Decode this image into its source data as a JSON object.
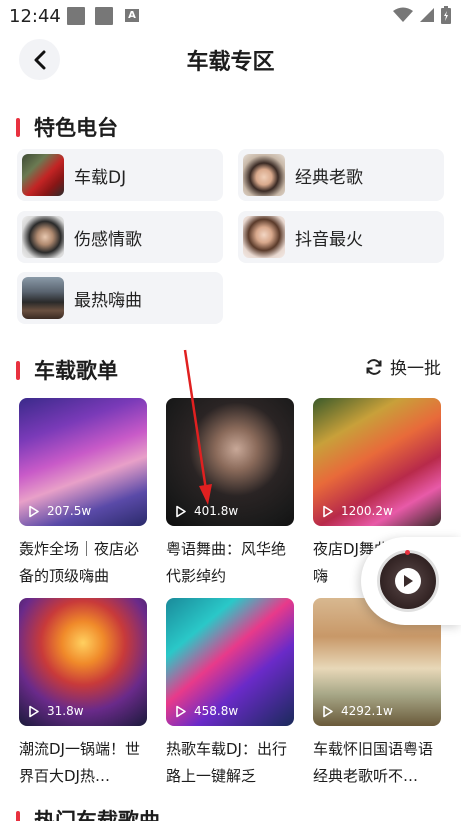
{
  "status": {
    "time": "12:44",
    "icon_a": "A"
  },
  "header": {
    "title": "车载专区"
  },
  "radio_section": {
    "title": "特色电台",
    "items": [
      {
        "label": "车载DJ"
      },
      {
        "label": "经典老歌"
      },
      {
        "label": "伤感情歌"
      },
      {
        "label": "抖音最火"
      },
      {
        "label": "最热嗨曲"
      }
    ]
  },
  "playlist_section": {
    "title": "车载歌单",
    "refresh_label": "换一批",
    "items": [
      {
        "count": "207.5w",
        "title": "轰炸全场｜夜店必备的顶级嗨曲"
      },
      {
        "count": "401.8w",
        "title": "粤语舞曲：风华绝代影绰约"
      },
      {
        "count": "1200.2w",
        "title": "夜店DJ舞曲AV8D嗨"
      },
      {
        "count": "31.8w",
        "title": "潮流DJ一锅端！世界百大DJ热…"
      },
      {
        "count": "458.8w",
        "title": "热歌车载DJ：出行路上一键解乏"
      },
      {
        "count": "4292.1w",
        "title": "车载怀旧国语粤语经典老歌听不…"
      }
    ]
  },
  "hot_section": {
    "title": "热门车载歌曲"
  },
  "colors": {
    "accent": "#e8313f",
    "card_bg": "#f3f4f7"
  }
}
